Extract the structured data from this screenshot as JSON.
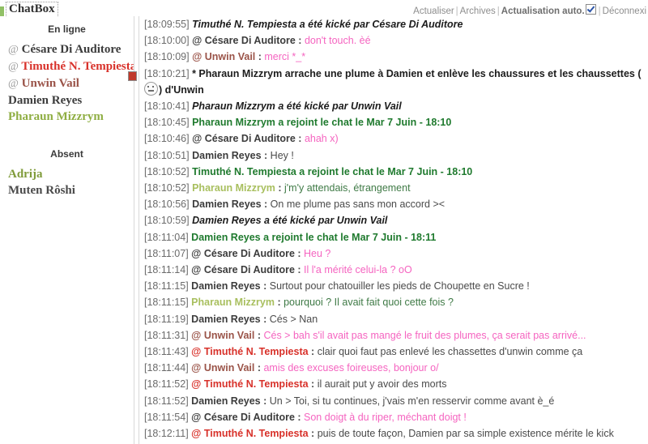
{
  "window": {
    "title": "ChatBox"
  },
  "header": {
    "refresh_label": "Actualiser",
    "archives_label": "Archives",
    "auto_refresh_label": "Actualisation auto.",
    "auto_refresh_checked": true,
    "logout_label": "Déconnexi",
    "separator": "|",
    "checkbox_icon": "checkbox-checked-icon"
  },
  "sidebar": {
    "online": {
      "title": "En ligne",
      "users": [
        {
          "at": "@",
          "name": "Césare Di Auditore",
          "color": "#3c3c3c"
        },
        {
          "at": "@",
          "name": "Timuthé N. Tempiesta",
          "color": "#d8312a"
        },
        {
          "at": "@",
          "name": "Unwin Vail",
          "color": "#9a5348"
        },
        {
          "at": "",
          "name": "Damien Reyes",
          "color": "#3c3c3c"
        },
        {
          "at": "",
          "name": "Pharaun Mizzrym",
          "color": "#8fae43"
        }
      ]
    },
    "absent": {
      "title": "Absent",
      "users": [
        {
          "at": "",
          "name": "Adrija",
          "color": "#7f9b3a"
        },
        {
          "at": "",
          "name": "Muten Rôshi",
          "color": "#4a4a4a"
        }
      ]
    },
    "broken_image_icon": "broken-image-icon"
  },
  "colors": {
    "accent_green": "#8fbf63",
    "join_green": "#1f7a2e",
    "pink": "#f564c0",
    "red": "#d8312a",
    "olive": "#8fae43",
    "pharaun_text": "#3f7a46",
    "neutral_text": "#4a4a4a",
    "timestamp": "#6b6b6b"
  },
  "chat": {
    "messages": [
      {
        "time": "[18:09:55]",
        "kind": "kick",
        "system_text": "Timuthé N. Tempiesta a été kické par Césare Di Auditore"
      },
      {
        "time": "[18:10:00]",
        "kind": "say",
        "at": "@",
        "name": "Césare Di Auditore",
        "name_color": "#3c3c3c",
        "text": "don't touch. èé",
        "text_color": "#f564c0"
      },
      {
        "time": "[18:10:09]",
        "kind": "say",
        "at": "@",
        "name": "Unwin Vail",
        "name_color": "#9a5348",
        "text": "merci *_*",
        "text_color": "#f564c0"
      },
      {
        "time": "[18:10:21]",
        "kind": "action",
        "system_text_before": "* Pharaun Mizzrym arrache une plume à Damien et enlève les chaussures et les chaussettes (",
        "emoticon": "smiley-icon",
        "system_text_after": ") d'Unwin"
      },
      {
        "time": "[18:10:41]",
        "kind": "kick",
        "system_text": "Pharaun Mizzrym a été kické par Unwin Vail"
      },
      {
        "time": "[18:10:45]",
        "kind": "join",
        "system_text": "Pharaun Mizzrym a rejoint le chat le Mar 7 Juin - 18:10"
      },
      {
        "time": "[18:10:46]",
        "kind": "say",
        "at": "@",
        "name": "Césare Di Auditore",
        "name_color": "#3c3c3c",
        "text": "ahah x)",
        "text_color": "#f564c0"
      },
      {
        "time": "[18:10:51]",
        "kind": "say",
        "at": "",
        "name": "Damien Reyes",
        "name_color": "#3c3c3c",
        "text": "Hey !",
        "text_color": "#4a4a4a"
      },
      {
        "time": "[18:10:52]",
        "kind": "join",
        "system_text": "Timuthé N. Tempiesta a rejoint le chat le Mar 7 Juin - 18:10"
      },
      {
        "time": "[18:10:52]",
        "kind": "say",
        "at": "",
        "name": "Pharaun Mizzrym",
        "name_color": "#a8bf5e",
        "text": "j'm'y attendais, étrangement",
        "text_color": "#3f7a46"
      },
      {
        "time": "[18:10:56]",
        "kind": "say",
        "at": "",
        "name": "Damien Reyes",
        "name_color": "#3c3c3c",
        "text": "On me plume pas sans mon accord ><",
        "text_color": "#4a4a4a"
      },
      {
        "time": "[18:10:59]",
        "kind": "kick",
        "system_text": "Damien Reyes a été kické par Unwin Vail"
      },
      {
        "time": "[18:11:04]",
        "kind": "join",
        "system_text": "Damien Reyes a rejoint le chat le Mar 7 Juin - 18:11"
      },
      {
        "time": "[18:11:07]",
        "kind": "say",
        "at": "@",
        "name": "Césare Di Auditore",
        "name_color": "#3c3c3c",
        "text": "Heu ?",
        "text_color": "#f564c0"
      },
      {
        "time": "[18:11:14]",
        "kind": "say",
        "at": "@",
        "name": "Césare Di Auditore",
        "name_color": "#3c3c3c",
        "text": "Il l'a mérité celui-la ? oO",
        "text_color": "#f564c0"
      },
      {
        "time": "[18:11:15]",
        "kind": "say",
        "at": "",
        "name": "Damien Reyes",
        "name_color": "#3c3c3c",
        "text": "Surtout pour chatouiller les pieds de Choupette en Sucre !",
        "text_color": "#4a4a4a"
      },
      {
        "time": "[18:11:15]",
        "kind": "say",
        "at": "",
        "name": "Pharaun Mizzrym",
        "name_color": "#a8bf5e",
        "text": "pourquoi ? Il avait fait quoi cette fois ?",
        "text_color": "#3f7a46"
      },
      {
        "time": "[18:11:19]",
        "kind": "say",
        "at": "",
        "name": "Damien Reyes",
        "name_color": "#3c3c3c",
        "text": "Cés > Nan",
        "text_color": "#4a4a4a"
      },
      {
        "time": "[18:11:31]",
        "kind": "say",
        "at": "@",
        "name": "Unwin Vail",
        "name_color": "#9a5348",
        "text": "Cés > bah s'il avait pas mangé le fruit des plumes, ça serait pas arrivé...",
        "text_color": "#f564c0"
      },
      {
        "time": "[18:11:43]",
        "kind": "say",
        "at": "@",
        "name": "Timuthé N. Tempiesta",
        "name_color": "#d8312a",
        "text": "clair quoi faut pas enlevé les chassettes d'unwin comme ça",
        "text_color": "#4a4a4a"
      },
      {
        "time": "[18:11:44]",
        "kind": "say",
        "at": "@",
        "name": "Unwin Vail",
        "name_color": "#9a5348",
        "text": "amis des excuses foireuses, bonjour o/",
        "text_color": "#f564c0"
      },
      {
        "time": "[18:11:52]",
        "kind": "say",
        "at": "@",
        "name": "Timuthé N. Tempiesta",
        "name_color": "#d8312a",
        "text": "il aurait put y avoir des morts",
        "text_color": "#4a4a4a"
      },
      {
        "time": "[18:11:52]",
        "kind": "say",
        "at": "",
        "name": "Damien Reyes",
        "name_color": "#3c3c3c",
        "text": "Un > Toi, si tu continues, j'vais m'en resservir comme avant è_é",
        "text_color": "#4a4a4a"
      },
      {
        "time": "[18:11:54]",
        "kind": "say",
        "at": "@",
        "name": "Césare Di Auditore",
        "name_color": "#3c3c3c",
        "text": "Son doigt à du riper, méchant doigt !",
        "text_color": "#f564c0"
      },
      {
        "time": "[18:12:11]",
        "kind": "say",
        "at": "@",
        "name": "Timuthé N. Tempiesta",
        "name_color": "#d8312a",
        "text": "puis de toute façon, Damien par sa simple existence mérite le kick",
        "text_color": "#4a4a4a"
      }
    ]
  }
}
